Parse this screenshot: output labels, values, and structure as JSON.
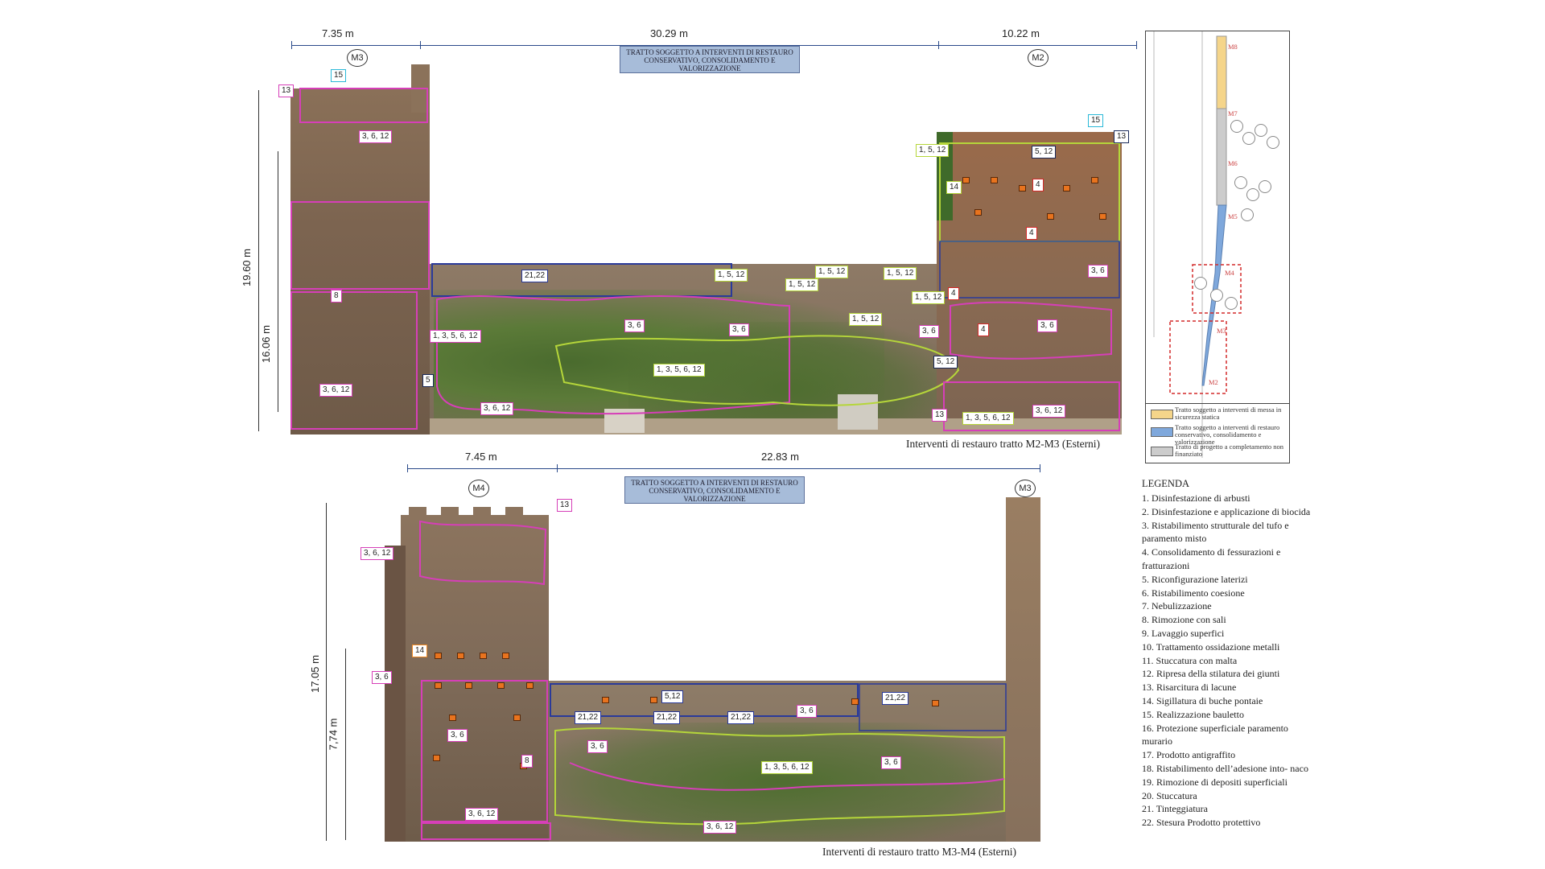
{
  "top": {
    "dims": [
      "7.35 m",
      "30.29 m",
      "10.22 m"
    ],
    "markers": [
      "M3",
      "M2"
    ],
    "banner": "TRATTO SOGGETTO A INTERVENTI DI RESTAURO CONSERVATIVO, CONSOLIDAMENTO E VALORIZZAZIONE",
    "height_outer": "19.60 m",
    "height_inner": "16.06 m",
    "caption": "Interventi di restauro tratto M2-M3 (Esterni)",
    "labels": [
      "15",
      "13",
      "3, 6, 12",
      "8",
      "3, 6, 12",
      "1, 3, 5, 6, 12",
      "5",
      "21,22",
      "3, 6",
      "3, 6",
      "1, 5, 12",
      "1, 5, 12",
      "1, 5, 12",
      "1, 5, 12",
      "1, 5, 12",
      "1, 5, 12",
      "1, 3, 5, 6, 12",
      "3, 6, 12",
      "15",
      "13",
      "1, 5, 12",
      "5, 12",
      "14",
      "4",
      "4",
      "3, 6",
      "4",
      "4",
      "3, 6",
      "3, 6",
      "5, 12",
      "13",
      "1, 3, 5, 6, 12",
      "3, 6, 12"
    ]
  },
  "bottom": {
    "dims": [
      "7.45 m",
      "22.83 m"
    ],
    "markers": [
      "M4",
      "M3"
    ],
    "banner": "TRATTO SOGGETTO A INTERVENTI DI RESTAURO CONSERVATIVO, CONSOLIDAMENTO E VALORIZZAZIONE",
    "height_outer": "17.05 m",
    "height_inner": "7,74 m",
    "caption": "Interventi di restauro tratto M3-M4 (Esterni)",
    "labels": [
      "13",
      "3, 6, 12",
      "14",
      "3, 6",
      "3, 6",
      "8",
      "3, 6, 12",
      "5,12",
      "21,22",
      "21,22",
      "21,22",
      "3, 6",
      "21,22",
      "3, 6",
      "1, 3, 5, 6, 12",
      "3, 6",
      "3, 6, 12"
    ]
  },
  "map": {
    "segments": [
      "M8",
      "M7",
      "M6",
      "M5",
      "M4",
      "M3",
      "M2"
    ],
    "key": [
      {
        "text": "Tratto soggetto a interventi di messa in sicurezza statica",
        "color": "#f5d58a"
      },
      {
        "text": "Tratto soggetto a interventi di restauro conservativo, consolidamento e valorizzazione",
        "color": "#7fa8dc"
      },
      {
        "text": "Tratto di progetto a completamento non finanziato",
        "color": "#cccccc"
      }
    ]
  },
  "legend": {
    "title": "LEGENDA",
    "items": [
      "1. Disinfestazione di arbusti",
      "2. Disinfestazione e applicazione di biocida",
      "3. Ristabilimento strutturale del tufo e paramento misto",
      "4. Consolidamento di fessurazioni e fratturazioni",
      "5. Riconfigurazione laterizi",
      "6. Ristabilimento coesione",
      "7. Nebulizzazione",
      "8. Rimozione con sali",
      "9. Lavaggio superfici",
      "10. Trattamento ossidazione metalli",
      "11. Stuccatura con malta",
      "12. Ripresa della stilatura dei giunti",
      "13. Risarcitura di lacune",
      "14. Sigillatura di buche pontaie",
      "15. Realizzazione bauletto",
      "16. Protezione superficiale paramento murario",
      "17. Prodotto antigraffito",
      "18. Ristabilimento dell’adesione into- naco",
      "19.  Rimozione di depositi superficiali",
      "20. Stuccatura",
      "21. Tinteggiatura",
      "22. Stesura Prodotto protettivo"
    ]
  }
}
